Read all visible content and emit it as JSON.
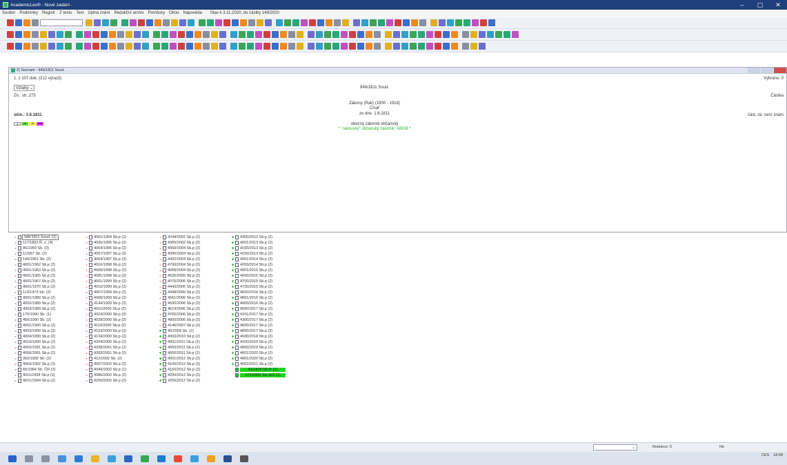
{
  "titlebar": {
    "title": "AcademicLex® - Nové zadání -",
    "min": "–",
    "max": "▢",
    "close": "✕"
  },
  "menu": {
    "items": [
      "Soubor",
      "Podmínky",
      "Registr",
      "Z textu",
      "Text",
      "Úplná znění",
      "Redukční archiv",
      "Pomůcky",
      "Okno",
      "Nápověda"
    ],
    "stav": "Stav k 3.11.2020, do částky 149/2020"
  },
  "toolbar": {
    "combo_value": ""
  },
  "doc_window": {
    "title": "2) Seznam - 946/1811 Soud.",
    "count": "1. z 107 dok. (212 výrazů)",
    "vztahy": "Vztahy",
    "zn": "Zn.: str. 275",
    "ucin": "účin.: 1.6.1811",
    "badges": [
      "18",
      "SB",
      "18",
      "SB"
    ],
    "ref": "946/1811 Soud.",
    "zakony": "Zákony (Rak) (1800 - 1918)",
    "cisar": "Císař",
    "ze_dne": "ze dne: 1.6.1811",
    "nazev": "obecný zákoník občanský",
    "alias": "* \"rakouský\" občanský zákoník; ABGB *",
    "vybrano": "Vybráno: 0",
    "castka": "Částka",
    "cast_ze": "část. ze: není znám"
  },
  "list": {
    "columns": [
      [
        {
          "s": "-",
          "r": "946/1811 Soud. (1)",
          "sel": true
        },
        {
          "s": "-",
          "r": "117/1852 Ř. z. (4)"
        },
        {
          "s": "-",
          "r": "86/1950 Sb. (3)"
        },
        {
          "s": "-",
          "r": "1/1957 Sb. (2)"
        },
        {
          "s": "-",
          "r": "140/1961 Sb. (2)"
        },
        {
          "s": "-",
          "r": "4001/1962 Sb.p (2)"
        },
        {
          "s": "-",
          "r": "4001/1963 Sb.p (2)"
        },
        {
          "s": "-",
          "r": "4001/1965 Sb.p (2)"
        },
        {
          "s": "-",
          "r": "4001/1967 Sb.p (2)"
        },
        {
          "s": "-",
          "r": "4001/1970 Sb.p (2)"
        },
        {
          "s": "-",
          "r": "113/1973 Sb. (2)"
        },
        {
          "s": "-",
          "r": "4001/1980 Sb.p (2)"
        },
        {
          "s": "-",
          "r": "4002/1989 Sb.p (2)"
        },
        {
          "s": "-",
          "r": "4003/1989 Sb.p (2)"
        },
        {
          "s": "-",
          "r": "175/1990 Sb. (1)"
        },
        {
          "s": "-",
          "r": "456/1990 Sb. (2)"
        },
        {
          "s": "-",
          "r": "4001/1990 Sb.p (2)"
        },
        {
          "s": "-",
          "r": "4003/1990 Sb.p (2)"
        },
        {
          "s": "-",
          "r": "4004/1990 Sb.p (2)"
        },
        {
          "s": "-",
          "r": "4010/1990 Sb.p (2)"
        },
        {
          "s": "-",
          "r": "4002/1991 Sb.p (2)"
        },
        {
          "s": "-",
          "r": "4056/1991 Sb.p (2)"
        },
        {
          "s": "-",
          "r": "392/1992 Sb. (2)"
        },
        {
          "s": "-",
          "r": "4063/1992 Sb.p (2)"
        },
        {
          "s": "-",
          "r": "65/1994 Sb. ČR (2)"
        },
        {
          "s": "-",
          "r": "4011/1994 Sb.p (2)"
        },
        {
          "s": "-",
          "r": "4021/1994 Sb.p (2)"
        }
      ],
      [
        {
          "s": "-",
          "r": "4061/1994 Sb.p (2)"
        },
        {
          "s": "-",
          "r": "4026/1995 Sb.p (2)"
        },
        {
          "s": "-",
          "r": "4054/1996 Sb.p (2)"
        },
        {
          "s": "-",
          "r": "4057/1997 Sb.p (2)"
        },
        {
          "s": "-",
          "r": "4064/1997 Sb.p (2)"
        },
        {
          "s": "-",
          "r": "4016/1998 Sb.p (2)"
        },
        {
          "s": "-",
          "r": "4069/1998 Sb.p (2)"
        },
        {
          "s": "-",
          "r": "4081/1998 Sb.p (2)"
        },
        {
          "s": "-",
          "r": "4001/1999 Sb.p (2)"
        },
        {
          "s": "-",
          "r": "4016/1999 Sb.p (2)"
        },
        {
          "s": "-",
          "r": "4067/1999 Sb.p (2)"
        },
        {
          "s": "-",
          "r": "4068/1999 Sb.p (2)"
        },
        {
          "s": "-",
          "r": "4144/1999 Sb.p (2)"
        },
        {
          "s": "-",
          "r": "4011/2000 Sb.p (2)"
        },
        {
          "s": "-",
          "r": "4024/2000 Sb.p (2)"
        },
        {
          "s": "-",
          "r": "4028/2000 Sb.p (2)"
        },
        {
          "s": "-",
          "r": "4114/2000 Sb.p (2)"
        },
        {
          "s": "-",
          "r": "4133/2000 Sb.p (2)"
        },
        {
          "s": "-",
          "r": "4134/2000 Sb.p (2)"
        },
        {
          "s": "-",
          "r": "4304/2000 Sb.p (2)"
        },
        {
          "s": "-",
          "r": "4208/2001 Sb.p (2)"
        },
        {
          "s": "-",
          "r": "4283/2001 Sb.p (2)"
        },
        {
          "s": "-",
          "r": "412/2002 Sb. (2)"
        },
        {
          "s": "-",
          "r": "4007/2002 Sb.p (2)"
        },
        {
          "s": "-",
          "r": "4049/2002 Sb.p (1)"
        },
        {
          "s": "-",
          "r": "4086/2002 Sb.p (2)"
        },
        {
          "s": "-",
          "r": "4209/2002 Sb.p (2)"
        }
      ],
      [
        {
          "s": "-",
          "r": "4244/2002 Sb.p (2)"
        },
        {
          "s": "-",
          "r": "4365/2002 Sb.p (2)"
        },
        {
          "s": "-",
          "r": "4058/2004 Sb.p (2)"
        },
        {
          "s": "-",
          "r": "4390/2004 Sb.p (2)"
        },
        {
          "s": "-",
          "r": "4402/2004 Sb.p (2)"
        },
        {
          "s": "-",
          "r": "4790/2004 Sb.p (2)"
        },
        {
          "s": "-",
          "r": "4958/2004 Sb.p (2)"
        },
        {
          "s": "-",
          "r": "4025/2005 Sb.p (2)"
        },
        {
          "s": "-",
          "r": "4076/2006 Sb.p (2)"
        },
        {
          "s": "-",
          "r": "4443/2006 Sb.p (2)"
        },
        {
          "s": "-",
          "r": "4498/2006 Sb.p (2)"
        },
        {
          "s": "-",
          "r": "4561/2006 Sb.p (2)"
        },
        {
          "s": "-",
          "r": "4590/2006 Sb.p (2)"
        },
        {
          "s": "-",
          "r": "4619/2006 Sb.p (2)"
        },
        {
          "s": "-",
          "r": "4755/2006 Sb.p (2)"
        },
        {
          "s": "-",
          "r": "4800/2006 Sb.p (2)"
        },
        {
          "s": "-",
          "r": "4146/2007 Sb.p (2)"
        },
        {
          "s": "+",
          "r": "40/2009 Sb. (2)"
        },
        {
          "s": "+",
          "r": "4003/2010 Sb.p (2)"
        },
        {
          "s": "+",
          "r": "4001/2011 Sb.p (2)"
        },
        {
          "s": "+",
          "r": "4600/2011 Sb.p (2)"
        },
        {
          "s": "+",
          "r": "4650/2011 Sb.p (2)"
        },
        {
          "s": "+",
          "r": "4001/2012 Sb.p (2)"
        },
        {
          "s": "+",
          "r": "4100/2012 Sb.p (2)"
        },
        {
          "s": "+",
          "r": "4150/2012 Sb.p (2)"
        },
        {
          "s": "+",
          "r": "4200/2012 Sb.p (2)"
        },
        {
          "s": "+",
          "r": "4250/2012 Sb.p (2)"
        }
      ],
      [
        {
          "s": "+",
          "r": "4300/2012 Sb.p (2)"
        },
        {
          "s": "+",
          "r": "4001/2013 Sb.p (2)"
        },
        {
          "s": "+",
          "r": "4100/2013 Sb.p (2)"
        },
        {
          "s": "+",
          "r": "4150/2013 Sb.p (2)"
        },
        {
          "s": "+",
          "r": "4001/2014 Sb.p (2)"
        },
        {
          "s": "+",
          "r": "4200/2014 Sb.p (2)"
        },
        {
          "s": "+",
          "r": "4001/2015 Sb.p (2)"
        },
        {
          "s": "+",
          "r": "4600/2015 Sb.p (2)"
        },
        {
          "s": "+",
          "r": "4700/2015 Sb.p (2)"
        },
        {
          "s": "+",
          "r": "4720/2015 Sb.p (2)"
        },
        {
          "s": "+",
          "r": "4600/2016 Sb.p (2)"
        },
        {
          "s": "+",
          "r": "4801/2016 Sb.p (2)"
        },
        {
          "s": "+",
          "r": "4900/2016 Sb.p (2)"
        },
        {
          "s": "+",
          "r": "4000/2017 Sb.p (2)"
        },
        {
          "s": "+",
          "r": "4101/2017 Sb.p (2)"
        },
        {
          "s": "+",
          "r": "4300/2017 Sb.p (2)"
        },
        {
          "s": "+",
          "r": "4600/2017 Sb.p (2)"
        },
        {
          "s": "+",
          "r": "4800/2017 Sb.p (2)"
        },
        {
          "s": "+",
          "r": "4030/2018 Sb.p (2)"
        },
        {
          "s": "+",
          "r": "4200/2019 Sb.p (2)"
        },
        {
          "s": "+",
          "r": "4900/2019 Sb.p (2)"
        },
        {
          "s": "+",
          "r": "4601/2020 Sb.p (2)"
        },
        {
          "s": "+",
          "r": "4901/2020 Sb.p (2)"
        },
        {
          "s": "+",
          "r": "4002/2021 Sb.p (2)"
        },
        {
          "s": "",
          "r": "41/1976 Sb.čr (1)",
          "hl": true
        },
        {
          "s": "",
          "r": "172/2000 Sb.čES (1)",
          "hl": true
        }
      ]
    ]
  },
  "statusbar": {
    "redukce": "Redukce:",
    "redukce_val": "0",
    "ne": "Ne"
  },
  "taskbar": {
    "lang": "CES",
    "time": "18:08"
  },
  "colors": {
    "title_bg": "#1e3f7a",
    "highlight": "#1fd41f",
    "minus": "#dd2222",
    "plus": "#11aa11",
    "alias": "#27b827"
  }
}
